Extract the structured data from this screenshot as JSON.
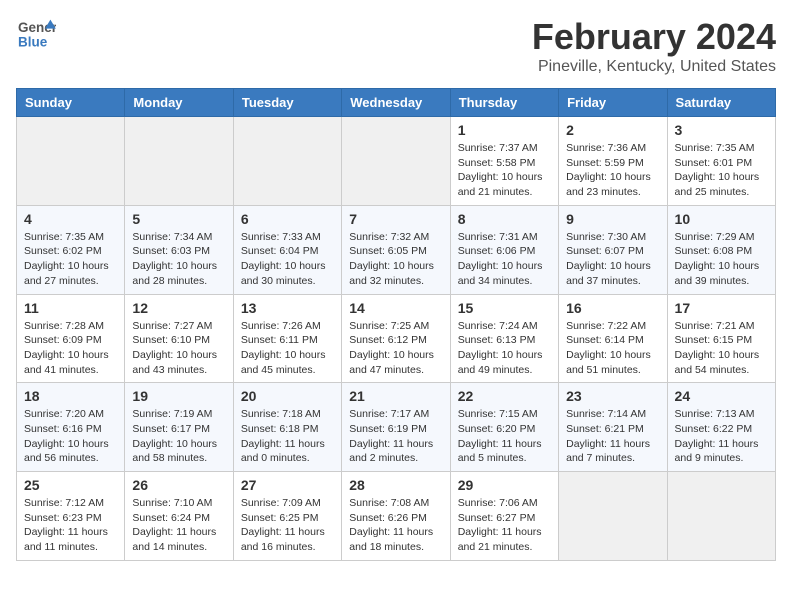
{
  "header": {
    "logo_line1": "General",
    "logo_line2": "Blue",
    "title": "February 2024",
    "subtitle": "Pineville, Kentucky, United States"
  },
  "calendar": {
    "days_of_week": [
      "Sunday",
      "Monday",
      "Tuesday",
      "Wednesday",
      "Thursday",
      "Friday",
      "Saturday"
    ],
    "weeks": [
      [
        {
          "date": "",
          "info": ""
        },
        {
          "date": "",
          "info": ""
        },
        {
          "date": "",
          "info": ""
        },
        {
          "date": "",
          "info": ""
        },
        {
          "date": "1",
          "info": "Sunrise: 7:37 AM\nSunset: 5:58 PM\nDaylight: 10 hours\nand 21 minutes."
        },
        {
          "date": "2",
          "info": "Sunrise: 7:36 AM\nSunset: 5:59 PM\nDaylight: 10 hours\nand 23 minutes."
        },
        {
          "date": "3",
          "info": "Sunrise: 7:35 AM\nSunset: 6:01 PM\nDaylight: 10 hours\nand 25 minutes."
        }
      ],
      [
        {
          "date": "4",
          "info": "Sunrise: 7:35 AM\nSunset: 6:02 PM\nDaylight: 10 hours\nand 27 minutes."
        },
        {
          "date": "5",
          "info": "Sunrise: 7:34 AM\nSunset: 6:03 PM\nDaylight: 10 hours\nand 28 minutes."
        },
        {
          "date": "6",
          "info": "Sunrise: 7:33 AM\nSunset: 6:04 PM\nDaylight: 10 hours\nand 30 minutes."
        },
        {
          "date": "7",
          "info": "Sunrise: 7:32 AM\nSunset: 6:05 PM\nDaylight: 10 hours\nand 32 minutes."
        },
        {
          "date": "8",
          "info": "Sunrise: 7:31 AM\nSunset: 6:06 PM\nDaylight: 10 hours\nand 34 minutes."
        },
        {
          "date": "9",
          "info": "Sunrise: 7:30 AM\nSunset: 6:07 PM\nDaylight: 10 hours\nand 37 minutes."
        },
        {
          "date": "10",
          "info": "Sunrise: 7:29 AM\nSunset: 6:08 PM\nDaylight: 10 hours\nand 39 minutes."
        }
      ],
      [
        {
          "date": "11",
          "info": "Sunrise: 7:28 AM\nSunset: 6:09 PM\nDaylight: 10 hours\nand 41 minutes."
        },
        {
          "date": "12",
          "info": "Sunrise: 7:27 AM\nSunset: 6:10 PM\nDaylight: 10 hours\nand 43 minutes."
        },
        {
          "date": "13",
          "info": "Sunrise: 7:26 AM\nSunset: 6:11 PM\nDaylight: 10 hours\nand 45 minutes."
        },
        {
          "date": "14",
          "info": "Sunrise: 7:25 AM\nSunset: 6:12 PM\nDaylight: 10 hours\nand 47 minutes."
        },
        {
          "date": "15",
          "info": "Sunrise: 7:24 AM\nSunset: 6:13 PM\nDaylight: 10 hours\nand 49 minutes."
        },
        {
          "date": "16",
          "info": "Sunrise: 7:22 AM\nSunset: 6:14 PM\nDaylight: 10 hours\nand 51 minutes."
        },
        {
          "date": "17",
          "info": "Sunrise: 7:21 AM\nSunset: 6:15 PM\nDaylight: 10 hours\nand 54 minutes."
        }
      ],
      [
        {
          "date": "18",
          "info": "Sunrise: 7:20 AM\nSunset: 6:16 PM\nDaylight: 10 hours\nand 56 minutes."
        },
        {
          "date": "19",
          "info": "Sunrise: 7:19 AM\nSunset: 6:17 PM\nDaylight: 10 hours\nand 58 minutes."
        },
        {
          "date": "20",
          "info": "Sunrise: 7:18 AM\nSunset: 6:18 PM\nDaylight: 11 hours\nand 0 minutes."
        },
        {
          "date": "21",
          "info": "Sunrise: 7:17 AM\nSunset: 6:19 PM\nDaylight: 11 hours\nand 2 minutes."
        },
        {
          "date": "22",
          "info": "Sunrise: 7:15 AM\nSunset: 6:20 PM\nDaylight: 11 hours\nand 5 minutes."
        },
        {
          "date": "23",
          "info": "Sunrise: 7:14 AM\nSunset: 6:21 PM\nDaylight: 11 hours\nand 7 minutes."
        },
        {
          "date": "24",
          "info": "Sunrise: 7:13 AM\nSunset: 6:22 PM\nDaylight: 11 hours\nand 9 minutes."
        }
      ],
      [
        {
          "date": "25",
          "info": "Sunrise: 7:12 AM\nSunset: 6:23 PM\nDaylight: 11 hours\nand 11 minutes."
        },
        {
          "date": "26",
          "info": "Sunrise: 7:10 AM\nSunset: 6:24 PM\nDaylight: 11 hours\nand 14 minutes."
        },
        {
          "date": "27",
          "info": "Sunrise: 7:09 AM\nSunset: 6:25 PM\nDaylight: 11 hours\nand 16 minutes."
        },
        {
          "date": "28",
          "info": "Sunrise: 7:08 AM\nSunset: 6:26 PM\nDaylight: 11 hours\nand 18 minutes."
        },
        {
          "date": "29",
          "info": "Sunrise: 7:06 AM\nSunset: 6:27 PM\nDaylight: 11 hours\nand 21 minutes."
        },
        {
          "date": "",
          "info": ""
        },
        {
          "date": "",
          "info": ""
        }
      ]
    ]
  }
}
